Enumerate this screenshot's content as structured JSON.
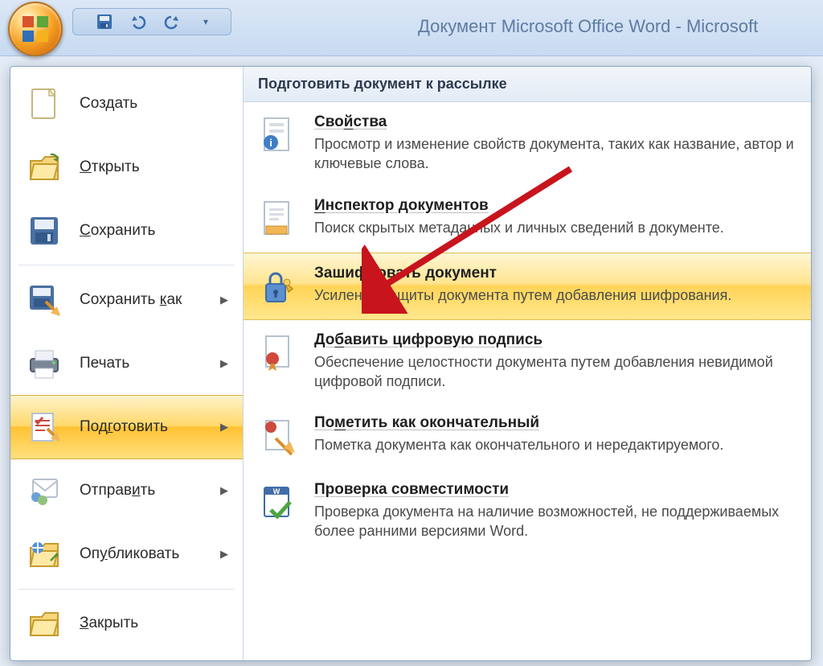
{
  "window": {
    "title": "Документ Microsoft Office Word - Microsoft "
  },
  "qat": {
    "save": "save",
    "undo": "undo",
    "redo": "redo"
  },
  "menu": {
    "items": [
      {
        "label": "Создать",
        "accel_index": -1,
        "has_submenu": false
      },
      {
        "label": "Открыть",
        "accel_index": 0,
        "has_submenu": false
      },
      {
        "label": "Сохранить",
        "accel_index": 0,
        "has_submenu": false
      },
      {
        "label": "Сохранить как",
        "accel_index": 10,
        "has_submenu": true
      },
      {
        "label": "Печать",
        "accel_index": -1,
        "has_submenu": true
      },
      {
        "label": "Подготовить",
        "accel_index": 3,
        "has_submenu": true,
        "selected": true
      },
      {
        "label": "Отправить",
        "accel_index": 6,
        "has_submenu": true
      },
      {
        "label": "Опубликовать",
        "accel_index": 2,
        "has_submenu": true
      },
      {
        "label": "Закрыть",
        "accel_index": 0,
        "has_submenu": false
      }
    ]
  },
  "right": {
    "header": "Подготовить документ к рассылке",
    "items": [
      {
        "title": "Свойства",
        "title_accel": 3,
        "desc": "Просмотр и изменение свойств документа, таких как название, автор и ключевые слова."
      },
      {
        "title": "Инспектор документов",
        "title_accel": 0,
        "desc": "Поиск скрытых метаданных и личных сведений в документе."
      },
      {
        "title": "Зашифровать документ",
        "title_accel": -1,
        "desc": "Усиление защиты документа путем добавления шифрования.",
        "highlight": true
      },
      {
        "title": "Добавить цифровую подпись",
        "title_accel": 2,
        "desc": "Обеспечение целостности документа путем добавления невидимой цифровой подписи."
      },
      {
        "title": "Пометить как окончательный",
        "title_accel": 2,
        "desc": "Пометка документа как окончательного и нередактируемого."
      },
      {
        "title": "Проверка совместимости",
        "title_accel": -1,
        "desc": "Проверка документа на наличие возможностей, не поддерживаемых более ранними версиями Word."
      }
    ]
  }
}
